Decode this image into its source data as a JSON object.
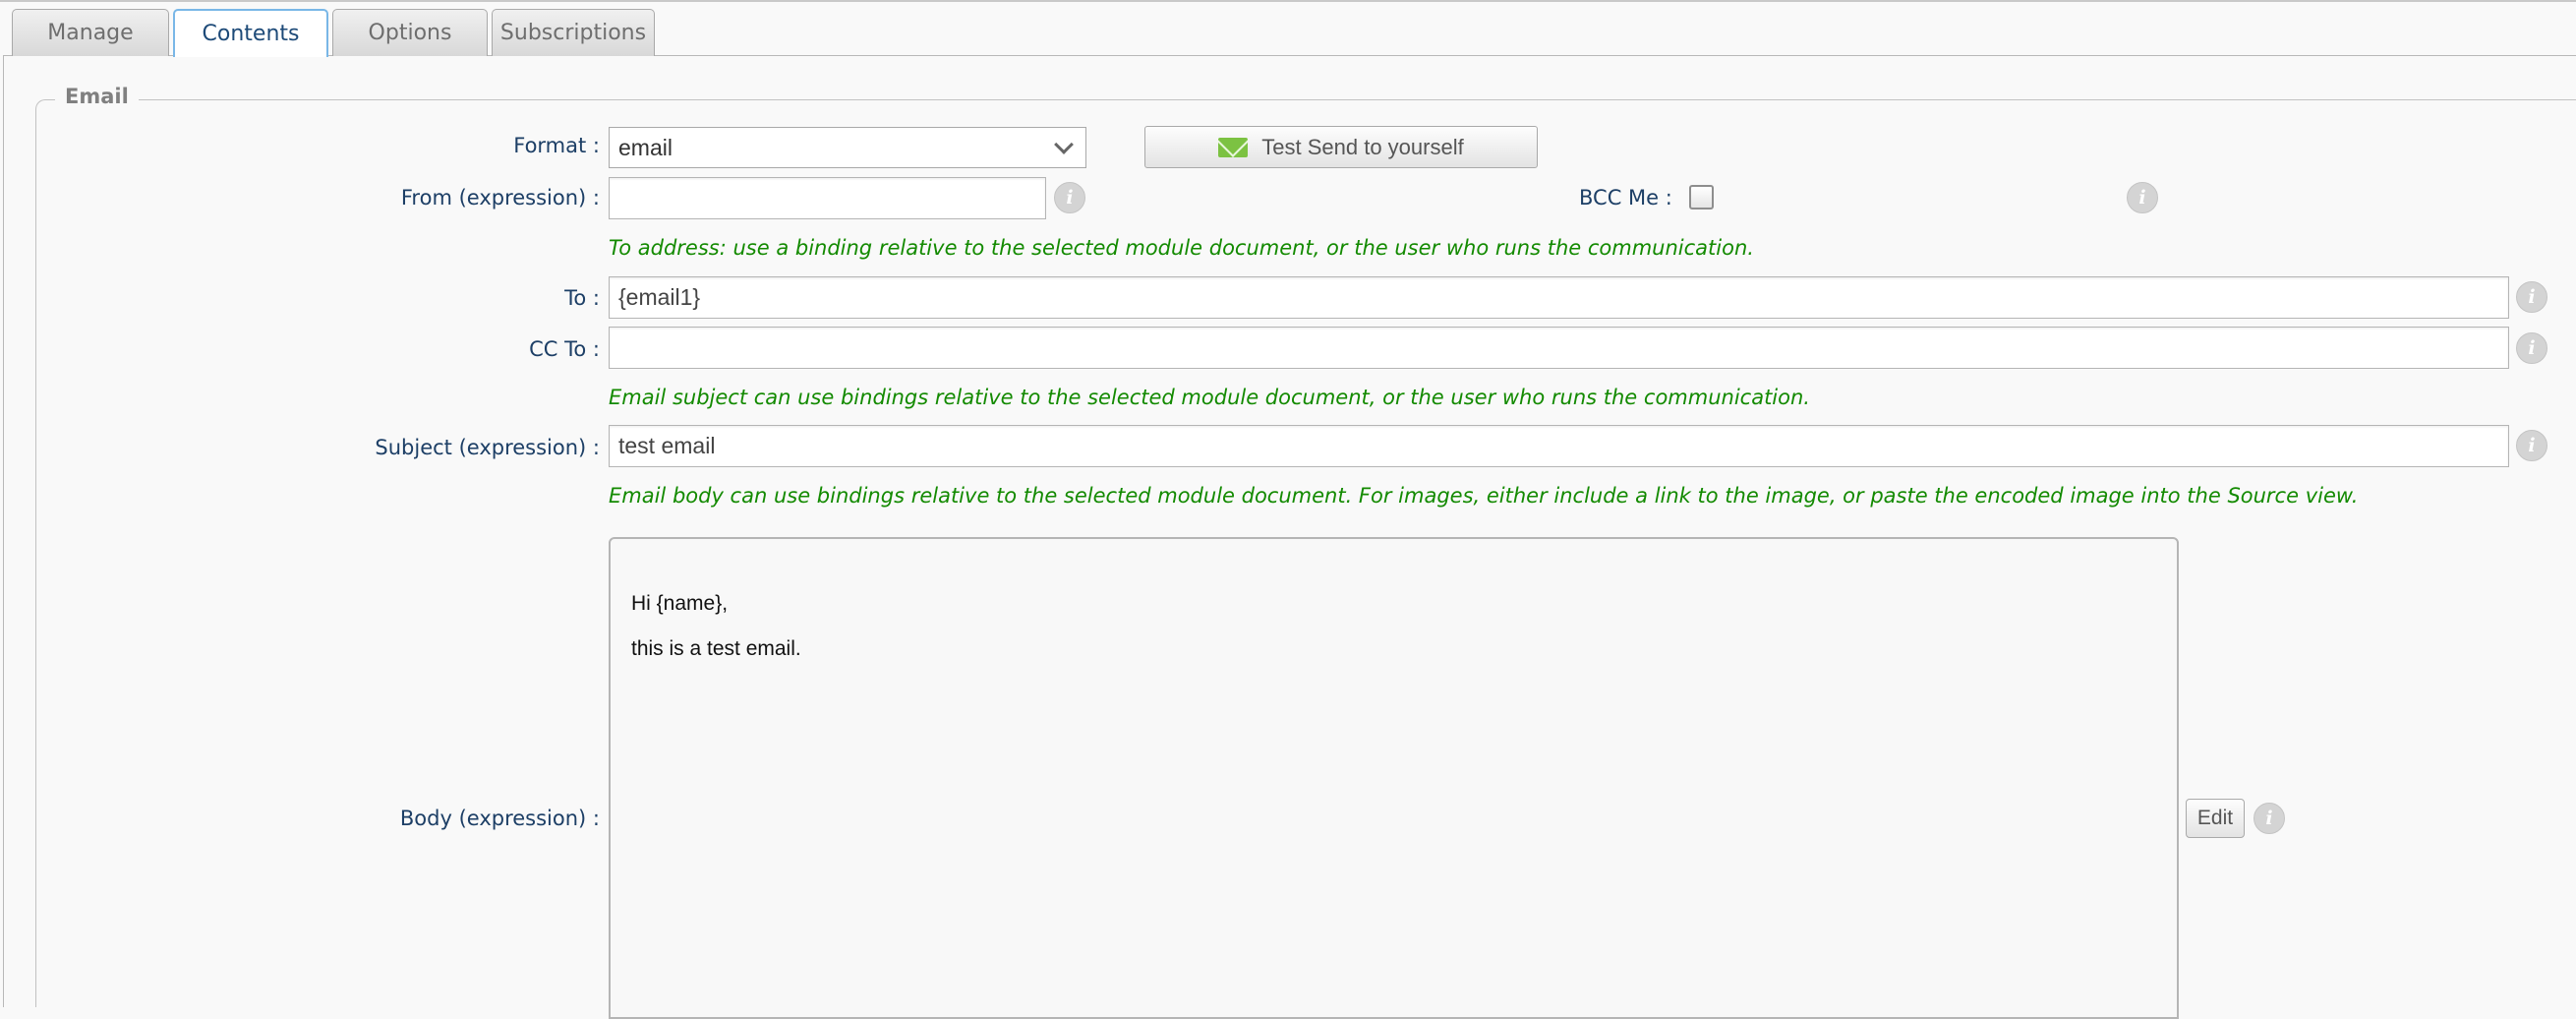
{
  "tabs": [
    {
      "label": "Manage",
      "active": false
    },
    {
      "label": "Contents",
      "active": true
    },
    {
      "label": "Options",
      "active": false
    },
    {
      "label": "Subscriptions",
      "active": false
    }
  ],
  "section": {
    "legend": "Email"
  },
  "format": {
    "label": "Format :",
    "value": "email"
  },
  "test_send": {
    "label": "Test Send to yourself",
    "icon": "envelope-icon",
    "icon_color": "#7cc242"
  },
  "from": {
    "label": "From (expression) :",
    "value": ""
  },
  "bcc": {
    "label": "BCC Me :",
    "checked": false
  },
  "hints": {
    "to": "To address: use a binding relative to the selected module document, or the user who runs the communication.",
    "subject": "Email subject can use bindings relative to the selected module document, or the user who runs the communication.",
    "body": "Email body can use bindings relative to the selected module document. For images, either include a link to the image, or paste the encoded image into the Source view."
  },
  "to": {
    "label": "To :",
    "value": "{email1}"
  },
  "cc": {
    "label": "CC To :",
    "value": ""
  },
  "subject": {
    "label": "Subject (expression) :",
    "value": "test email"
  },
  "body": {
    "label": "Body (expression) :",
    "lines": [
      "Hi {name},",
      "this is a test email."
    ],
    "edit_label": "Edit"
  },
  "info_glyph": "i",
  "colors": {
    "label": "#1d3f66",
    "hint": "#138a00",
    "active_tab_border": "#79b7e7"
  }
}
